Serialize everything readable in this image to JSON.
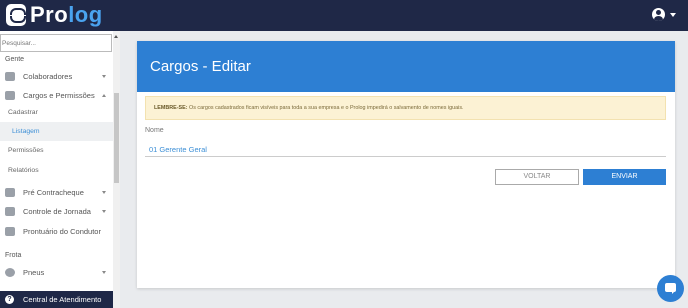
{
  "app": {
    "logo_prefix": "Pro",
    "logo_suffix": "log",
    "accent_color": "#4aa3ef",
    "topbar_color": "#1f2847",
    "account_icon": "account-circle-icon"
  },
  "sidebar": {
    "search_placeholder": "Pesquisar...",
    "section_gente": "Gente",
    "colaboradores": "Colaboradores",
    "cargos": "Cargos e Permissões",
    "cadastrar": "Cadastrar",
    "listagem": "Listagem",
    "permissoes": "Permissões",
    "relatorios": "Relatórios",
    "pre_contracheque": "Pré Contracheque",
    "controle_jornada": "Controle de Jornada",
    "prontuario": "Prontuário do Condutor",
    "section_frota": "Frota",
    "pneus": "Pneus",
    "central": "Central de Atendimento"
  },
  "main": {
    "title": "Cargos - Editar",
    "notice_label": "LEMBRE-SE:",
    "notice_text": " Os cargos cadastrados ficam visíveis para toda a sua empresa e o Prolog impedirá o salvamento de nomes iguais.",
    "field_label": "Nome",
    "field_value": "01 Gerente Geral",
    "back_label": "VOLTAR",
    "send_label": "ENVIAR",
    "primary_color": "#2d7fd3"
  }
}
